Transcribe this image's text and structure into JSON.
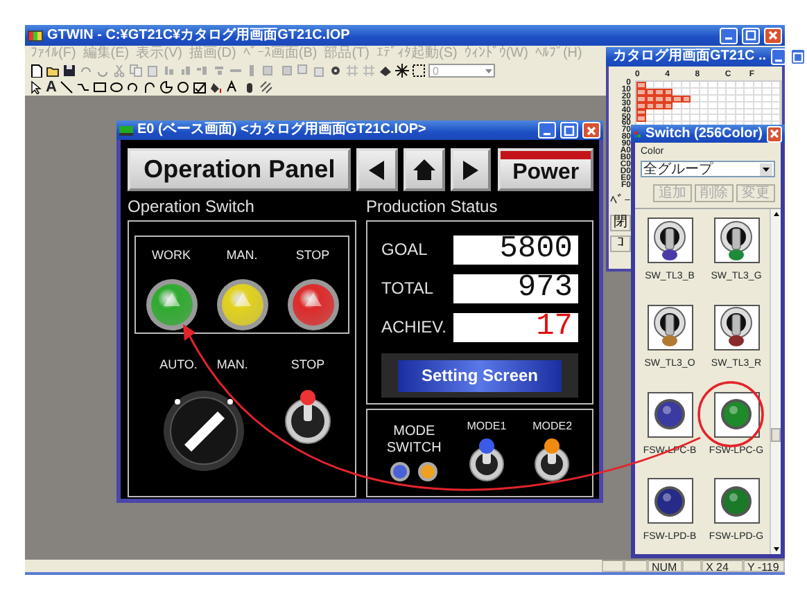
{
  "app_window": {
    "title": "GTWIN - C:¥GT21C¥カタログ用画面GT21C.IOP"
  },
  "menu": [
    {
      "label": "ﾌｧｲﾙ(F)",
      "disabled": true
    },
    {
      "label": "編集(E)",
      "disabled": true
    },
    {
      "label": "表示(V)",
      "disabled": true
    },
    {
      "label": "描画(D)",
      "disabled": true
    },
    {
      "label": "ﾍﾞｰｽ画面(B)",
      "disabled": true
    },
    {
      "label": "部品(T)",
      "disabled": true
    },
    {
      "label": "ｴﾃﾞｨﾀ起動(S)",
      "disabled": true
    },
    {
      "label": "ｳｨﾝﾄﾞｳ(W)",
      "disabled": true
    },
    {
      "label": "ﾍﾙﾌﾟ(H)",
      "disabled": true
    }
  ],
  "toolbar": {
    "combo": {
      "value": "0",
      "disabled": true
    },
    "text_tool": "A"
  },
  "screen_window": {
    "title": "E0 (ベース画面) <カタログ用画面GT21C.IOP>",
    "panel": {
      "title": "Operation Panel",
      "power": "Power",
      "operation_switch": {
        "title": "Operation Switch",
        "lamps": [
          {
            "label": "WORK",
            "color": "#2faa2f"
          },
          {
            "label": "MAN.",
            "color": "#e2d21c"
          },
          {
            "label": "STOP",
            "color": "#de2a2a"
          }
        ],
        "selector": {
          "labels": [
            "AUTO.",
            "MAN."
          ],
          "on": true
        },
        "toggle": {
          "label": "STOP",
          "on": true
        }
      },
      "production_status": {
        "title": "Production Status",
        "rows": [
          {
            "label": "GOAL",
            "value": "5800",
            "alert": false
          },
          {
            "label": "TOTAL",
            "value": "973",
            "alert": false
          },
          {
            "label": "ACHIEV.",
            "value": "17",
            "alert": true
          }
        ],
        "setting_button": "Setting Screen"
      },
      "mode": {
        "label": "MODE SWITCH",
        "lamps": [
          {
            "color": "#4a62d8"
          },
          {
            "color": "#f0a020"
          }
        ],
        "toggles": [
          {
            "label": "MODE1",
            "color": "#3a5ae8"
          },
          {
            "label": "MODE2",
            "color": "#f08a10"
          }
        ]
      }
    }
  },
  "screen_list_window": {
    "title": "カタログ用画面GT21C ..",
    "columns": [
      "0",
      "4",
      "8",
      "C",
      "F"
    ],
    "rows": [
      {
        "label": "0",
        "used": [
          true
        ]
      },
      {
        "label": "10",
        "used": [
          true,
          true,
          true,
          true
        ]
      },
      {
        "label": "20",
        "used": [
          true,
          true,
          true,
          true,
          true,
          true
        ]
      },
      {
        "label": "30",
        "used": [
          true,
          true,
          true,
          true
        ]
      },
      {
        "label": "40",
        "used": [
          true
        ]
      },
      {
        "label": "50",
        "used": [
          true
        ]
      },
      {
        "label": "60",
        "used": []
      },
      {
        "label": "70",
        "used": []
      },
      {
        "label": "80",
        "used": []
      },
      {
        "label": "90",
        "used": []
      },
      {
        "label": "A0",
        "used": []
      },
      {
        "label": "B0",
        "used": []
      },
      {
        "label": "C0",
        "used": []
      },
      {
        "label": "D0",
        "used": []
      },
      {
        "label": "E0",
        "used": []
      },
      {
        "label": "F0",
        "used": []
      }
    ],
    "tab": "ﾍﾞｰ",
    "buttons": [
      "閉",
      "ｺ"
    ]
  },
  "palette": {
    "title": "Switch (256Color)",
    "color_label": "Color",
    "group": "全グループ",
    "buttons": [
      {
        "label": "追加",
        "disabled": true
      },
      {
        "label": "削除",
        "disabled": true
      },
      {
        "label": "変更",
        "disabled": true
      }
    ],
    "items": [
      {
        "name": "SW_TL3_B",
        "kind": "toggle",
        "color": "#4a3aa8"
      },
      {
        "name": "SW_TL3_G",
        "kind": "toggle",
        "color": "#1f8a3a"
      },
      {
        "name": "SW_TL3_O",
        "kind": "toggle",
        "color": "#b07a30"
      },
      {
        "name": "SW_TL3_R",
        "kind": "toggle",
        "color": "#8a2a2a"
      },
      {
        "name": "FSW-LPC-B",
        "kind": "lamp",
        "color": "#3a3aa0"
      },
      {
        "name": "FSW-LPC-G",
        "kind": "lamp",
        "color": "#1e8a2a"
      },
      {
        "name": "FSW-LPD-B",
        "kind": "lamp",
        "color": "#262a88"
      },
      {
        "name": "FSW-LPD-G",
        "kind": "lamp",
        "color": "#1a7a28"
      }
    ]
  },
  "status_bar": [
    "NUM",
    "X  24",
    "Y -119"
  ]
}
